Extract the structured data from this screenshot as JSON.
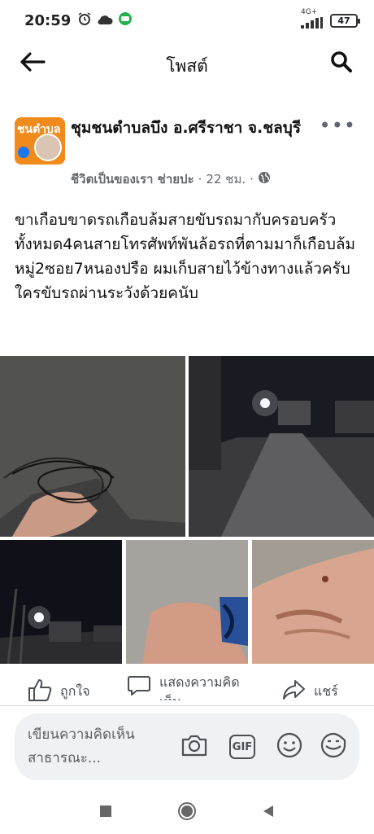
{
  "status_bar": {
    "time": "20:59",
    "network_label": "4G+",
    "battery": "47"
  },
  "header": {
    "title": "โพสต์"
  },
  "post": {
    "group_name": "ชุมชนตำบลบึง อ.ศรีราชา จ.ชลบุรี",
    "avatar_text": "ชนตำบล",
    "author": "ชีวิตเป็นของเรา ช่ายปะ",
    "separator": "·",
    "time_ago": "22 ชม.",
    "text": "ขาเกือบขาดรถเกือบล้มสายขับรถมากับครอบครัวทั้งหมด4คนสายโทรศัพท์พันล้อรถที่ตามมาก็เกือบล้ม หมู่2ซอย7หนองปรือ ผมเก็บสายไว้ข้างทางแล้วครับ ใครขับรถผ่านระวังด้วยคนับ"
  },
  "actions": {
    "like": "ถูกใจ",
    "comment": "แสดงความคิดเห็น",
    "share": "แชร์"
  },
  "comment_bar": {
    "placeholder": "เขียนความคิดเห็นสาธารณะ...",
    "gif_label": "GIF"
  },
  "colors": {
    "accent": "#1877f2",
    "avatar_bg": "#f08a1a",
    "icon_gray": "#4b4f56"
  }
}
